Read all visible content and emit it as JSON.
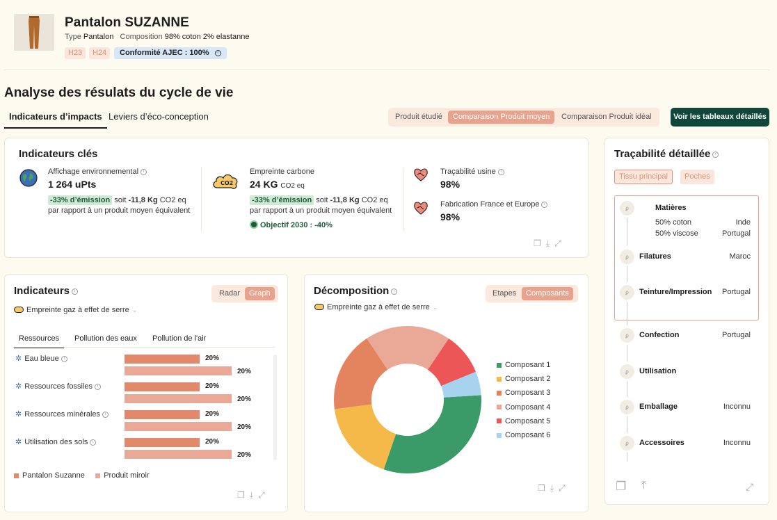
{
  "product": {
    "title": "Pantalon SUZANNE",
    "type_label": "Type",
    "type_value": "Pantalon",
    "composition_label": "Composition",
    "composition_value": "98% coton 2% elastanne",
    "seasons": [
      "H23",
      "H24"
    ],
    "conformity": "Conformité AJEC : 100%"
  },
  "section_title": "Analyse des résulats du cycle de vie",
  "tabs": [
    "Indicateurs d’impacts",
    "Leviers d’éco-conception"
  ],
  "comparison": {
    "options": [
      "Produit étudié",
      "Comparaison Produit moyen",
      "Comparaison Produit idéal"
    ],
    "selected": "Comparaison Produit moyen"
  },
  "detailed_tables_button": "Voir les tableaux détaillés",
  "key_indicators": {
    "title": "Indicateurs clés",
    "environmental": {
      "label": "Affichage environnemental",
      "value": "1 264 uPts",
      "tag": "-33% d’émission",
      "soit": "soit",
      "diff": "-11,8 Kg",
      "unit": "CO2 eq",
      "note": "par rapport à un produit moyen équivalent"
    },
    "carbon": {
      "label": "Empreinte carbone",
      "value": "24 KG",
      "value_unit": "CO2 eq",
      "tag": "-33% d’émission",
      "soit": "soit",
      "diff": "-11,8 Kg",
      "unit": "CO2 eq",
      "note": "par rapport à un produit moyen équivalent",
      "objective": "Objectif 2030 : -40%"
    },
    "traceability": {
      "label": "Traçabilité usine",
      "value": "98%"
    },
    "made_in": {
      "label": "Fabrication France et Europe",
      "value": "98%"
    }
  },
  "indicators": {
    "title": "Indicateurs",
    "view_options": [
      "Radar",
      "Graph"
    ],
    "view_selected": "Graph",
    "metric": "Empreinte gaz à effet de serre",
    "subtabs": [
      "Ressources",
      "Pollution des eaux",
      "Pollution de l'air"
    ],
    "legend": [
      "Pantalon Suzanne",
      "Produit miroir"
    ],
    "colors": {
      "series1": "#e2896c",
      "series2": "#eaa996"
    }
  },
  "chart_data": [
    {
      "type": "bar",
      "categories": [
        "Eau bleue",
        "Ressources fossiles",
        "Ressources minérales",
        "Utilisation des sols"
      ],
      "series": [
        {
          "name": "Pantalon Suzanne",
          "values": [
            20,
            20,
            20,
            20
          ]
        },
        {
          "name": "Produit miroir",
          "values": [
            20,
            20,
            20,
            20
          ]
        }
      ],
      "value_labels": [
        "20%",
        "20%",
        "20%",
        "20%"
      ],
      "title": "Indicateurs"
    },
    {
      "type": "pie",
      "title": "Décomposition",
      "labels": [
        "Composant 1",
        "Composant 2",
        "Composant 3",
        "Composant 4",
        "Composant 5",
        "Composant 6"
      ],
      "values": [
        30,
        17,
        17,
        18,
        9,
        5
      ],
      "colors": [
        "#3a9a68",
        "#f5b94a",
        "#e3845f",
        "#eaa996",
        "#ec5656",
        "#a8d3ef"
      ]
    }
  ],
  "decomposition": {
    "title": "Décomposition",
    "view_options": [
      "Etapes",
      "Composants"
    ],
    "view_selected": "Composants",
    "metric": "Empreinte gaz à effet de serre"
  },
  "traceability_detail": {
    "title": "Traçabilité détaillée",
    "chips": [
      "Tissu principal",
      "Poches"
    ],
    "selected_chip": "Tissu principal",
    "steps": [
      {
        "label": "Matières",
        "value": ""
      },
      {
        "label": "Filatures",
        "value": "Maroc"
      },
      {
        "label": "Teinture/Impression",
        "value": "Portugal"
      },
      {
        "label": "Confection",
        "value": "Portugal"
      },
      {
        "label": "Utilisation",
        "value": ""
      },
      {
        "label": "Emballage",
        "value": "Inconnu"
      },
      {
        "label": "Accessoires",
        "value": "Inconnu"
      }
    ],
    "materials": [
      {
        "name": "50% coton",
        "origin": "Inde"
      },
      {
        "name": "50% viscose",
        "origin": "Portugal"
      }
    ]
  }
}
